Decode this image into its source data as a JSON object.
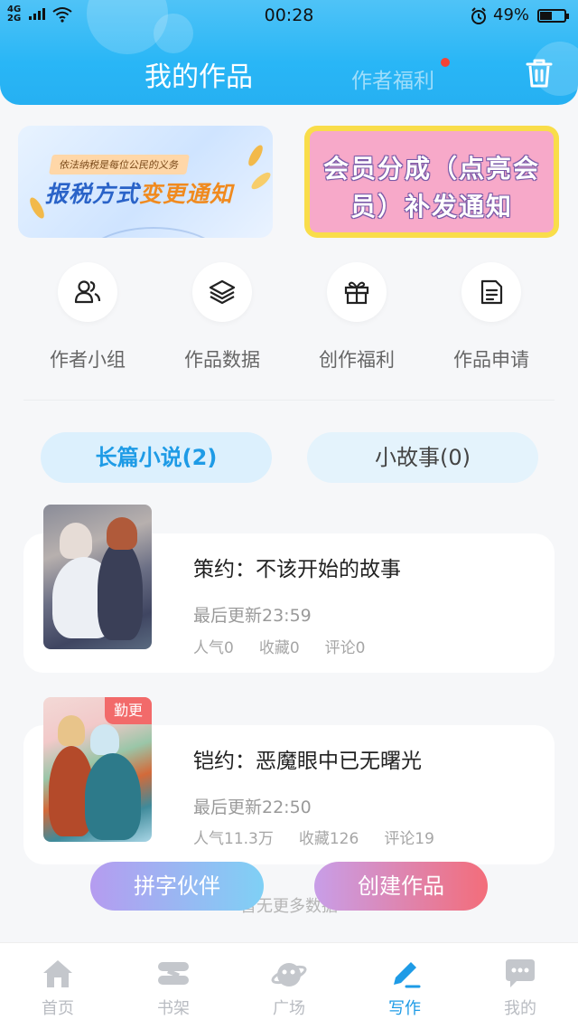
{
  "status_bar": {
    "network": "4G⁺\n2G",
    "time": "00:28",
    "battery": "49%"
  },
  "header": {
    "title": "我的作品",
    "benefit_tab": "作者福利",
    "trash_icon": "trash-icon"
  },
  "banners": [
    {
      "small_text": "依法纳税是每位公民的义务",
      "title_a": "报税方式",
      "title_b": "变更通知"
    },
    {
      "line1": "会员分成（点亮会",
      "line2": "员）补发通知"
    }
  ],
  "quick_actions": [
    {
      "label": "作者小组",
      "icon": "users-icon"
    },
    {
      "label": "作品数据",
      "icon": "layers-icon"
    },
    {
      "label": "创作福利",
      "icon": "gift-icon"
    },
    {
      "label": "作品申请",
      "icon": "document-icon"
    }
  ],
  "tabs": [
    {
      "label": "长篇小说(2)",
      "active": true
    },
    {
      "label": "小故事(0)",
      "active": false
    }
  ],
  "works": [
    {
      "title": "策约：不该开始的故事",
      "updated": "最后更新23:59",
      "popularity": "人气0",
      "favorites": "收藏0",
      "comments": "评论0",
      "badge": ""
    },
    {
      "title": "铠约：恶魔眼中已无曙光",
      "updated": "最后更新22:50",
      "popularity": "人气11.3万",
      "favorites": "收藏126",
      "comments": "评论19",
      "badge": "勤更"
    }
  ],
  "no_more_text": "暂无更多数据",
  "floating_buttons": {
    "partner": "拼字伙伴",
    "create": "创建作品"
  },
  "bottom_nav": [
    {
      "label": "首页",
      "icon": "home-icon",
      "active": false
    },
    {
      "label": "书架",
      "icon": "bookshelf-icon",
      "active": false
    },
    {
      "label": "广场",
      "icon": "planet-icon",
      "active": false
    },
    {
      "label": "写作",
      "icon": "pen-icon",
      "active": true
    },
    {
      "label": "我的",
      "icon": "chat-bubble-icon",
      "active": false
    }
  ],
  "colors": {
    "header_blue": "#29b6f6",
    "accent": "#1e9be6",
    "badge_red": "#f26a6a",
    "notification_dot": "#f44336"
  }
}
